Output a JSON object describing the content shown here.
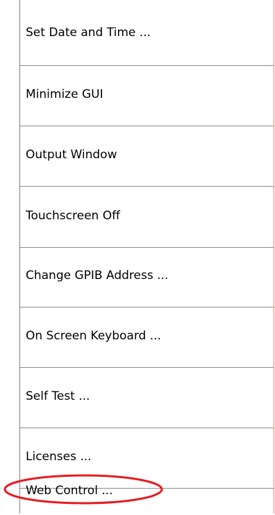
{
  "menu": {
    "items": [
      {
        "label": "Set Date and Time ..."
      },
      {
        "label": "Minimize GUI"
      },
      {
        "label": "Output Window"
      },
      {
        "label": "Touchscreen Off"
      },
      {
        "label": "Change GPIB Address ..."
      },
      {
        "label": "On Screen Keyboard ..."
      },
      {
        "label": "Self Test ..."
      },
      {
        "label": "Licenses ..."
      },
      {
        "label": "Web Control ..."
      }
    ]
  },
  "colors": {
    "highlight_ellipse": "#e8191e",
    "divider": "#8a8a8a",
    "right_edge": "#ff7a7a"
  }
}
